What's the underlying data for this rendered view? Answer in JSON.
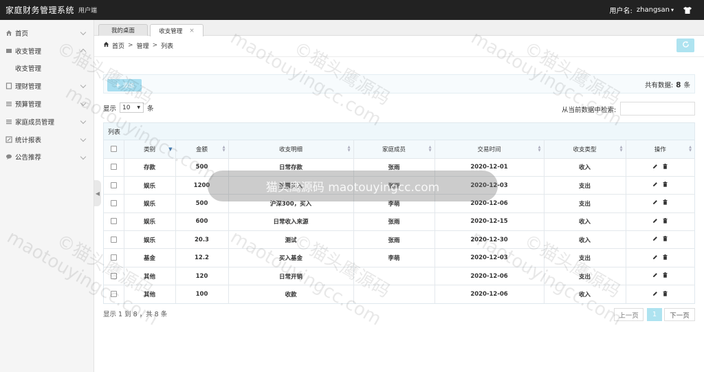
{
  "topbar": {
    "app_title": "家庭财务管理系统",
    "app_sub": "用户端",
    "user_label": "用户名:",
    "user_name": "zhangsan",
    "user_caret": "▾"
  },
  "sidebar": {
    "items": [
      {
        "label": "首页",
        "icon": "home-icon"
      },
      {
        "label": "收支管理",
        "icon": "list-icon"
      },
      {
        "label": "收支管理",
        "sub": true
      },
      {
        "label": "理财管理",
        "icon": "file-icon"
      },
      {
        "label": "预算管理",
        "icon": "list-icon"
      },
      {
        "label": "家庭成员管理",
        "icon": "list-icon"
      },
      {
        "label": "统计报表",
        "icon": "edit-icon"
      },
      {
        "label": "公告推荐",
        "icon": "chat-icon"
      }
    ]
  },
  "tabs": [
    {
      "label": "我的桌面"
    },
    {
      "label": "收支管理",
      "close": "×"
    }
  ],
  "breadcrumb": {
    "home": "首页",
    "sep": ">",
    "manage": "管理",
    "list": "列表"
  },
  "toolbar": {
    "add_label": "添加",
    "total_prefix": "共有数据:",
    "total_count": "8",
    "total_suffix": "条"
  },
  "length": {
    "prefix": "显示",
    "value": "10",
    "suffix": "条"
  },
  "search": {
    "label": "从当前数据中检索:"
  },
  "table": {
    "caption": "列表",
    "headers": [
      "类别",
      "金额",
      "收支明细",
      "家庭成员",
      "交易时间",
      "收支类型",
      "操作"
    ],
    "rows": [
      [
        "存款",
        "500",
        "日常存款",
        "张雨",
        "2020-12-01",
        "收入"
      ],
      [
        "娱乐",
        "1200",
        "股票买入",
        "张雨",
        "2020-12-03",
        "支出"
      ],
      [
        "娱乐",
        "500",
        "沪深300，买入",
        "李萌",
        "2020-12-06",
        "支出"
      ],
      [
        "娱乐",
        "600",
        "日常收入来源",
        "张雨",
        "2020-12-15",
        "收入"
      ],
      [
        "娱乐",
        "20.3",
        "测试",
        "张雨",
        "2020-12-30",
        "收入"
      ],
      [
        "基金",
        "12.2",
        "买入基金",
        "李萌",
        "2020-12-03",
        "支出"
      ],
      [
        "其他",
        "120",
        "日常开销",
        "",
        "2020-12-06",
        "支出"
      ],
      [
        "其他",
        "100",
        "收款",
        "",
        "2020-12-06",
        "收入"
      ]
    ]
  },
  "footer": {
    "info": "显示 1 到 8 ，共 8 条",
    "prev": "上一页",
    "current": "1",
    "next": "下一页"
  },
  "watermark": {
    "text": "©猫头鹰源码",
    "url": "maotouyingcc.com",
    "center": "猫头鹰源码 maotouyingcc.com"
  },
  "colors": {
    "topbar": "#222222",
    "accent_light": "#aee3f0",
    "sidebar_bg": "#f5f5f5"
  }
}
